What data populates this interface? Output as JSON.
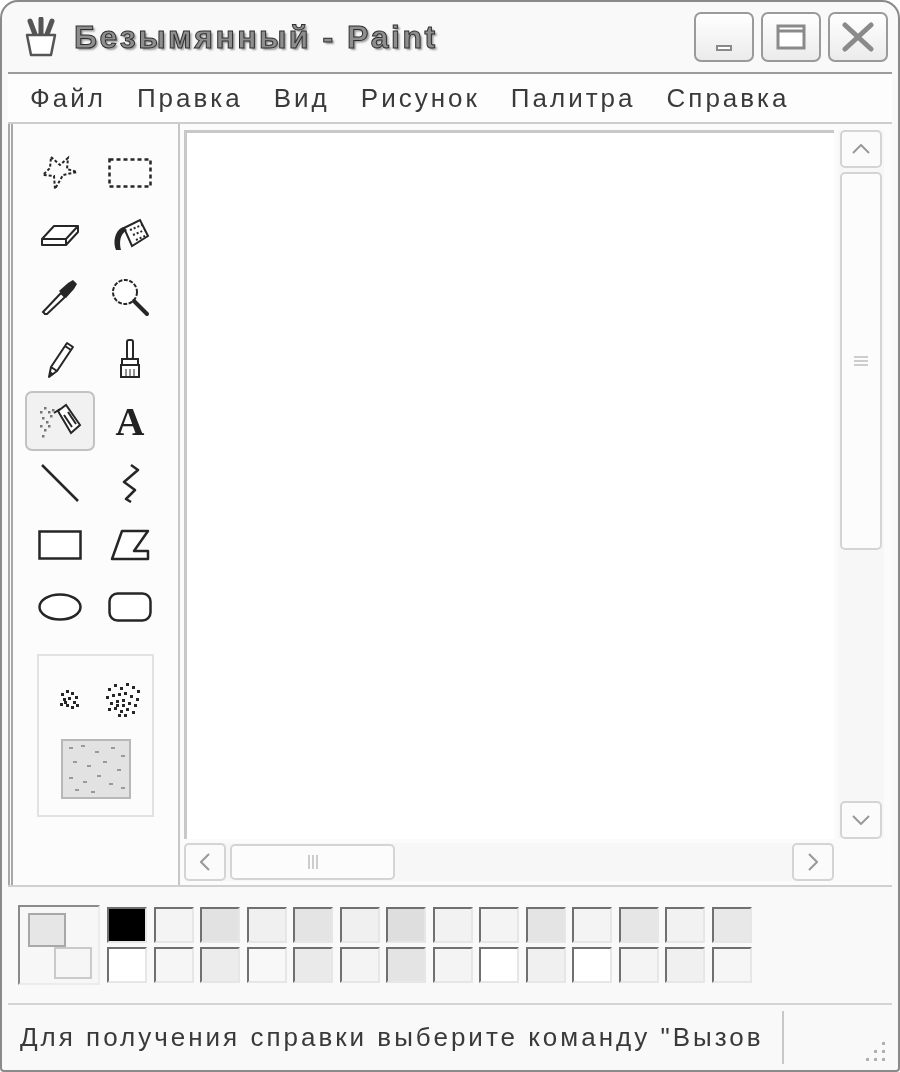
{
  "window": {
    "title": "Безымянный - Paint"
  },
  "menu": [
    {
      "label": "Файл"
    },
    {
      "label": "Правка"
    },
    {
      "label": "Вид"
    },
    {
      "label": "Рисунок"
    },
    {
      "label": "Палитра"
    },
    {
      "label": "Справка"
    }
  ],
  "tools": [
    {
      "kind": "free-select",
      "selected": false
    },
    {
      "kind": "select",
      "selected": false
    },
    {
      "kind": "eraser",
      "selected": false
    },
    {
      "kind": "fill",
      "selected": false
    },
    {
      "kind": "picker",
      "selected": false
    },
    {
      "kind": "magnifier",
      "selected": false
    },
    {
      "kind": "pencil",
      "selected": false
    },
    {
      "kind": "brush",
      "selected": false
    },
    {
      "kind": "airbrush",
      "selected": true
    },
    {
      "kind": "text",
      "glyph": "A",
      "selected": false
    },
    {
      "kind": "line",
      "selected": false
    },
    {
      "kind": "curve",
      "selected": false
    },
    {
      "kind": "rectangle",
      "selected": false
    },
    {
      "kind": "polygon",
      "selected": false
    },
    {
      "kind": "ellipse",
      "selected": false
    },
    {
      "kind": "rounded-rectangle",
      "selected": false
    }
  ],
  "tool_options": [
    {
      "kind": "spray-small",
      "selected": false
    },
    {
      "kind": "spray-medium",
      "selected": false
    },
    {
      "kind": "spray-large",
      "selected": false
    }
  ],
  "palette": {
    "current": [
      {
        "color": "#e6e6e6"
      },
      {
        "color": "#f6f6f6"
      }
    ],
    "colors": [
      {
        "color": "#000000"
      },
      {
        "color": "#f4f4f4"
      },
      {
        "color": "#e2e2e2"
      },
      {
        "color": "#f0f0f0"
      },
      {
        "color": "#e4e4e4"
      },
      {
        "color": "#f0f0f0"
      },
      {
        "color": "#dedede"
      },
      {
        "color": "#f2f2f2"
      },
      {
        "color": "#f4f4f4"
      },
      {
        "color": "#e4e4e4"
      },
      {
        "color": "#f4f4f4"
      },
      {
        "color": "#e6e6e6"
      },
      {
        "color": "#f2f2f2"
      },
      {
        "color": "#e8e8e8"
      },
      {
        "color": "#ffffff"
      },
      {
        "color": "#f6f6f6"
      },
      {
        "color": "#ececec"
      },
      {
        "color": "#f8f8f8"
      },
      {
        "color": "#eaeaea"
      },
      {
        "color": "#f4f4f4"
      },
      {
        "color": "#e4e4e4"
      },
      {
        "color": "#f4f4f4"
      },
      {
        "color": "#ffffff"
      },
      {
        "color": "#f0f0f0"
      },
      {
        "color": "#ffffff"
      },
      {
        "color": "#f4f4f4"
      },
      {
        "color": "#f0f0f0"
      },
      {
        "color": "#f6f6f6"
      }
    ]
  },
  "status_bar": {
    "text": "Для получения справки выберите команду \"Вызов"
  }
}
